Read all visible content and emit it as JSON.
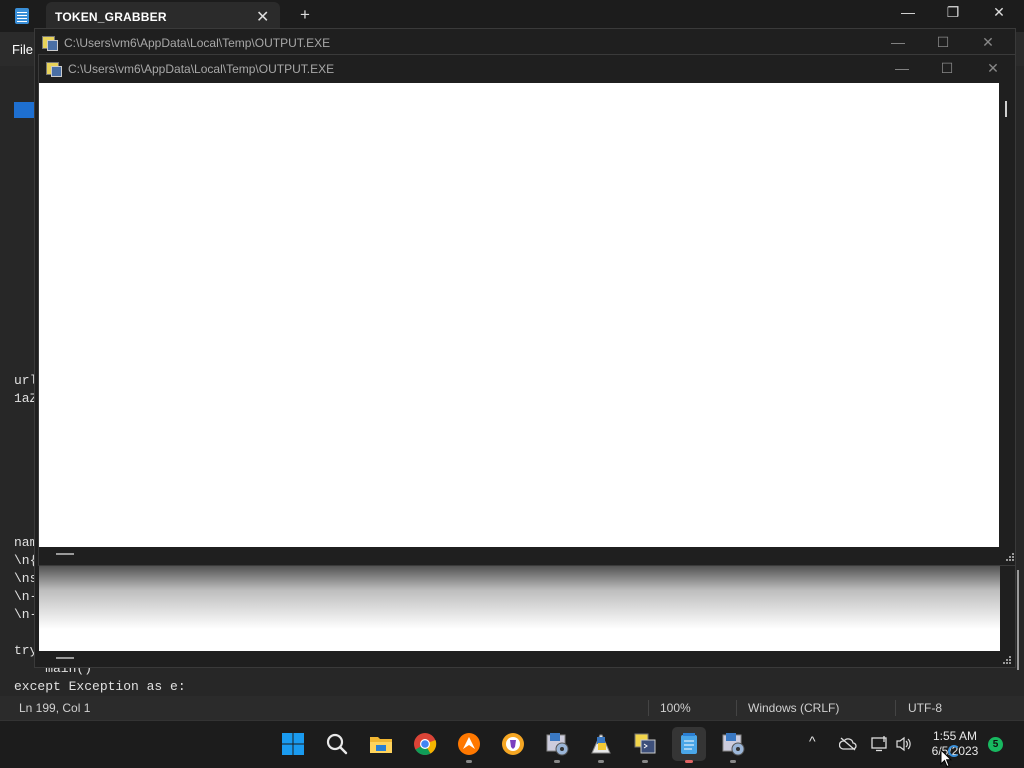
{
  "notepad": {
    "tab_title": "TOKEN_GRABBER",
    "close_tab_glyph": "✕",
    "new_tab_glyph": "+",
    "menu_file": "File",
    "window_controls": {
      "minimize": "—",
      "restore": "❐",
      "close": "✕"
    },
    "code_lines": [
      "url",
      "1aZ",
      "nam",
      "\\n{",
      "\\ns",
      "\\n-",
      "\\n-",
      "try",
      "    main()",
      "except Exception as e:"
    ],
    "status": {
      "position": "Ln 199, Col 1",
      "zoom": "100%",
      "line_ending": "Windows (CRLF)",
      "encoding": "UTF-8"
    }
  },
  "console_back": {
    "path": "C:\\Users\\vm6\\AppData\\Local\\Temp\\OUTPUT.EXE",
    "controls": {
      "minimize": "—",
      "maximize": "☐",
      "close": "✕"
    }
  },
  "console_front": {
    "path": "C:\\Users\\vm6\\AppData\\Local\\Temp\\OUTPUT.EXE",
    "controls": {
      "minimize": "—",
      "maximize": "☐",
      "close": "✕"
    }
  },
  "taskbar": {
    "icons": [
      "windows-start-icon",
      "search-icon",
      "file-explorer-icon",
      "chrome-icon",
      "avast-icon",
      "brave-icon",
      "python-setup-icon",
      "python-idle-icon",
      "python-exe-icon",
      "notepad-icon",
      "python-setup-2-icon"
    ],
    "tray": {
      "chevron": "^",
      "clock_time": "1:55 AM",
      "clock_date": "6/5/2023",
      "notifications": "5"
    }
  },
  "colors": {
    "accent": "#1e6fd0",
    "console_bg": "#1f1f1f",
    "client": "#ffffff"
  }
}
